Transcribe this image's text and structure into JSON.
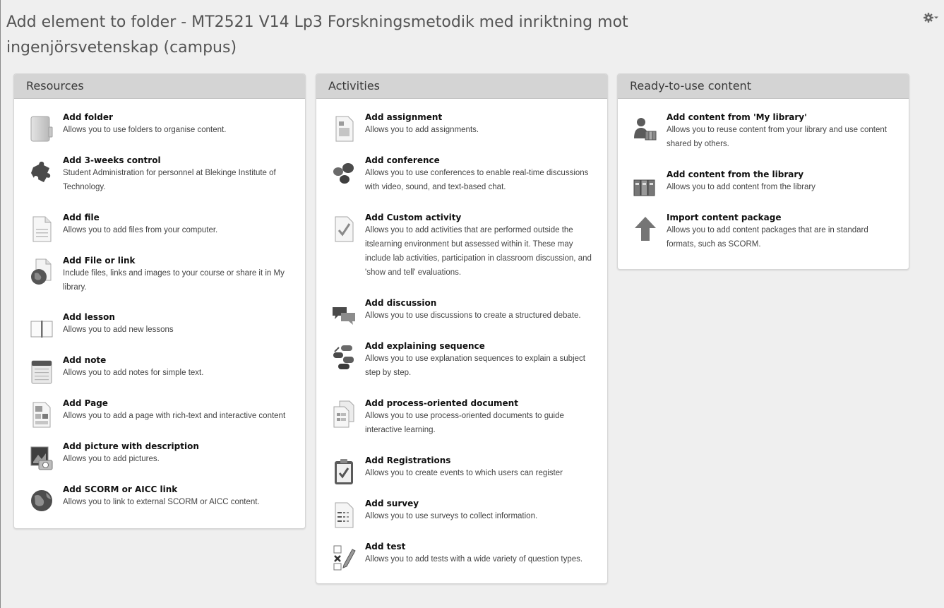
{
  "page": {
    "title": "Add element to folder - MT2521 V14 Lp3 Forskningsmetodik med inriktning mot ingenjörsvetenskap (campus)"
  },
  "panels": {
    "resources": {
      "header": "Resources",
      "items": [
        {
          "title": "Add folder",
          "desc": "Allows you to use folders to organise content.",
          "icon": "folder-icon"
        },
        {
          "title": "Add 3-weeks control",
          "desc": "Student Administration for personnel at Blekinge Institute of Technology.",
          "icon": "puzzle-icon"
        },
        {
          "title": "Add file",
          "desc": "Allows you to add files from your computer.",
          "icon": "file-icon"
        },
        {
          "title": "Add File or link",
          "desc": "Include files, links and images to your course or share it in My library.",
          "icon": "file-link-globe-icon"
        },
        {
          "title": "Add lesson",
          "desc": "Allows you to add new lessons",
          "icon": "book-icon"
        },
        {
          "title": "Add note",
          "desc": "Allows you to add notes for simple text.",
          "icon": "note-icon"
        },
        {
          "title": "Add Page",
          "desc": "Allows you to add a page with rich-text and interactive content",
          "icon": "page-icon"
        },
        {
          "title": "Add picture with description",
          "desc": "Allows you to add pictures.",
          "icon": "picture-camera-icon"
        },
        {
          "title": "Add SCORM or AICC link",
          "desc": "Allows you to link to external SCORM or AICC content.",
          "icon": "globe-icon"
        }
      ]
    },
    "activities": {
      "header": "Activities",
      "items": [
        {
          "title": "Add assignment",
          "desc": "Allows you to add assignments.",
          "icon": "assignment-icon"
        },
        {
          "title": "Add conference",
          "desc": "Allows you to use conferences to enable real-time discussions with video, sound, and text-based chat.",
          "icon": "conference-icon"
        },
        {
          "title": "Add Custom activity",
          "desc": "Allows you to add activities that are performed outside the itslearning environment but assessed within it. These may include lab activities, participation in classroom discussion, and 'show and tell' evaluations.",
          "icon": "checkmark-document-icon"
        },
        {
          "title": "Add discussion",
          "desc": "Allows you to use discussions to create a structured debate.",
          "icon": "speech-bubbles-icon"
        },
        {
          "title": "Add explaining sequence",
          "desc": "Allows you to use explanation sequences to explain a subject step by step.",
          "icon": "sequence-icon"
        },
        {
          "title": "Add process-oriented document",
          "desc": "Allows you to use process-oriented documents to guide interactive learning.",
          "icon": "process-document-icon"
        },
        {
          "title": "Add Registrations",
          "desc": "Allows you to create events to which users can register",
          "icon": "clipboard-check-icon"
        },
        {
          "title": "Add survey",
          "desc": "Allows you to use surveys to collect information.",
          "icon": "survey-icon"
        },
        {
          "title": "Add test",
          "desc": "Allows you to add tests with a wide variety of question types.",
          "icon": "test-icon"
        }
      ]
    },
    "ready": {
      "header": "Ready-to-use content",
      "items": [
        {
          "title": "Add content from 'My library'",
          "desc": "Allows you to reuse content from your library and use content shared by others.",
          "icon": "person-library-icon"
        },
        {
          "title": "Add content from the library",
          "desc": "Allows you to add content from the library",
          "icon": "binders-icon"
        },
        {
          "title": "Import content package",
          "desc": "Allows you to add content packages that are in standard formats, such as SCORM.",
          "icon": "upload-arrow-icon"
        }
      ]
    }
  }
}
